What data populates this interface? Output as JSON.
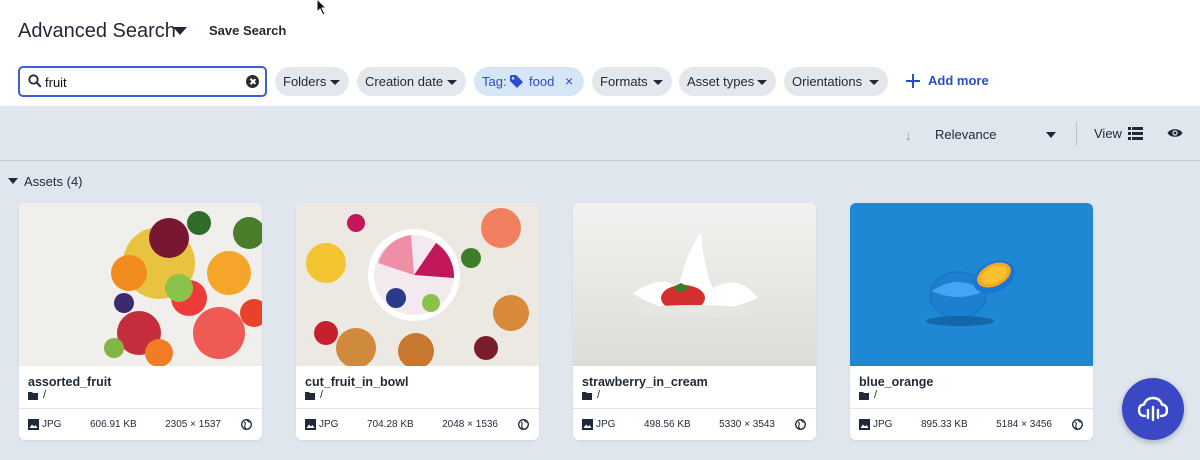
{
  "header": {
    "title": "Advanced Search",
    "save_search": "Save Search"
  },
  "search": {
    "value": "fruit",
    "placeholder": ""
  },
  "filters": {
    "folders": "Folders",
    "creation_date": "Creation date",
    "tag_label": "Tag:",
    "tag_value": "food",
    "tag_remove": "×",
    "formats": "Formats",
    "asset_types": "Asset types",
    "orientations": "Orientations",
    "add_more": "Add more"
  },
  "toolbar": {
    "sort_arrow": "↓",
    "sort": "Relevance",
    "view_label": "View"
  },
  "assets": {
    "header": "Assets (4)",
    "items": [
      {
        "name": "assorted_fruit",
        "folder": "/",
        "format": "JPG",
        "size": "606.91 KB",
        "dimensions": "2305 × 1537"
      },
      {
        "name": "cut_fruit_in_bowl",
        "folder": "/",
        "format": "JPG",
        "size": "704.28 KB",
        "dimensions": "2048 × 1536"
      },
      {
        "name": "strawberry_in_cream",
        "folder": "/",
        "format": "JPG",
        "size": "498.56 KB",
        "dimensions": "5330 × 3543"
      },
      {
        "name": "blue_orange",
        "folder": "/",
        "format": "JPG",
        "size": "895.33 KB",
        "dimensions": "5184 × 3456"
      }
    ]
  },
  "colors": {
    "accent": "#2a4ec9",
    "fab": "#3a48c5",
    "content_bg": "#dfe6ee",
    "tag_chip_bg": "#d6e6f7"
  },
  "icons": [
    "dropdown-caret-icon",
    "search-icon",
    "clear-icon",
    "tag-icon",
    "plus-icon",
    "sort-arrow-icon",
    "list-view-icon",
    "eye-icon",
    "folder-icon",
    "image-icon",
    "globe-icon",
    "cloud-upload-icon"
  ]
}
